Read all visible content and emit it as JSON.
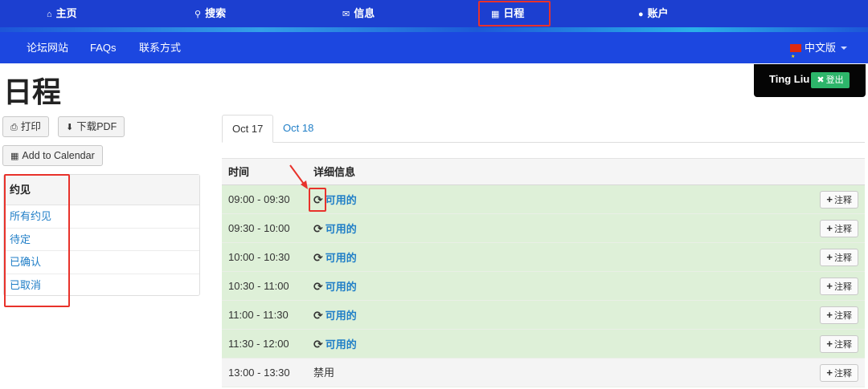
{
  "topnav": {
    "items": [
      {
        "icon": "home-icon",
        "glyph": "⌂",
        "label": "主页"
      },
      {
        "icon": "search-icon",
        "glyph": "🔍",
        "label": "搜索"
      },
      {
        "icon": "envelope-icon",
        "glyph": "✉",
        "label": "信息"
      },
      {
        "icon": "calendar-icon",
        "glyph": "▦",
        "label": "日程"
      },
      {
        "icon": "user-icon",
        "glyph": "👤",
        "label": "账户"
      }
    ],
    "highlighted": "日程"
  },
  "subnav": {
    "items": [
      "论坛网站",
      "FAQs",
      "联系方式"
    ],
    "language": "中文版"
  },
  "page": {
    "title": "日程"
  },
  "user": {
    "name": "Ting Liu",
    "logout_label": "登出"
  },
  "buttons": {
    "print": "打印",
    "download_pdf": "下载PDF",
    "add_calendar": "Add to Calendar"
  },
  "appointments_panel": {
    "title": "约见",
    "items": [
      "所有约见",
      "待定",
      "已确认",
      "已取消"
    ]
  },
  "tabs": [
    {
      "label": "Oct 17",
      "active": true
    },
    {
      "label": "Oct 18",
      "active": false
    }
  ],
  "schedule": {
    "columns": [
      "时间",
      "详细信息"
    ],
    "note_label": "注释",
    "rows": [
      {
        "time": "09:00 - 09:30",
        "status": "可用的",
        "available": true
      },
      {
        "time": "09:30 - 10:00",
        "status": "可用的",
        "available": true
      },
      {
        "time": "10:00 - 10:30",
        "status": "可用的",
        "available": true
      },
      {
        "time": "10:30 - 11:00",
        "status": "可用的",
        "available": true
      },
      {
        "time": "11:00 - 11:30",
        "status": "可用的",
        "available": true
      },
      {
        "time": "11:30 - 12:00",
        "status": "可用的",
        "available": true
      },
      {
        "time": "13:00 - 13:30",
        "status": "禁用",
        "available": false
      }
    ]
  },
  "colors": {
    "nav_bg": "#1c3fd0",
    "subnav_bg": "#1c47e0",
    "available_row": "#def0d8",
    "link": "#1f7ec7",
    "highlight": "#e8322b"
  }
}
